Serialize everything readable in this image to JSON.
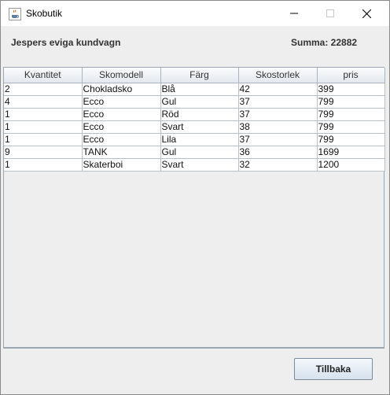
{
  "window": {
    "title": "Skobutik",
    "icon": "java-coffee-icon"
  },
  "header": {
    "cart_title": "Jespers eviga kundvagn",
    "summa": "Summa: 22882"
  },
  "table": {
    "columns": [
      "Kvantitet",
      "Skomodell",
      "Färg",
      "Skostorlek",
      "pris"
    ],
    "rows": [
      [
        "2",
        "Chokladsko",
        "Blå",
        "42",
        "399"
      ],
      [
        "4",
        "Ecco",
        "Gul",
        "37",
        "799"
      ],
      [
        "1",
        "Ecco",
        "Röd",
        "37",
        "799"
      ],
      [
        "1",
        "Ecco",
        "Svart",
        "38",
        "799"
      ],
      [
        "1",
        "Ecco",
        "Lila",
        "37",
        "799"
      ],
      [
        "9",
        "TANK",
        "Gul",
        "36",
        "1699"
      ],
      [
        "1",
        "Skaterboi",
        "Svart",
        "32",
        "1200"
      ]
    ]
  },
  "footer": {
    "back_label": "Tillbaka"
  }
}
